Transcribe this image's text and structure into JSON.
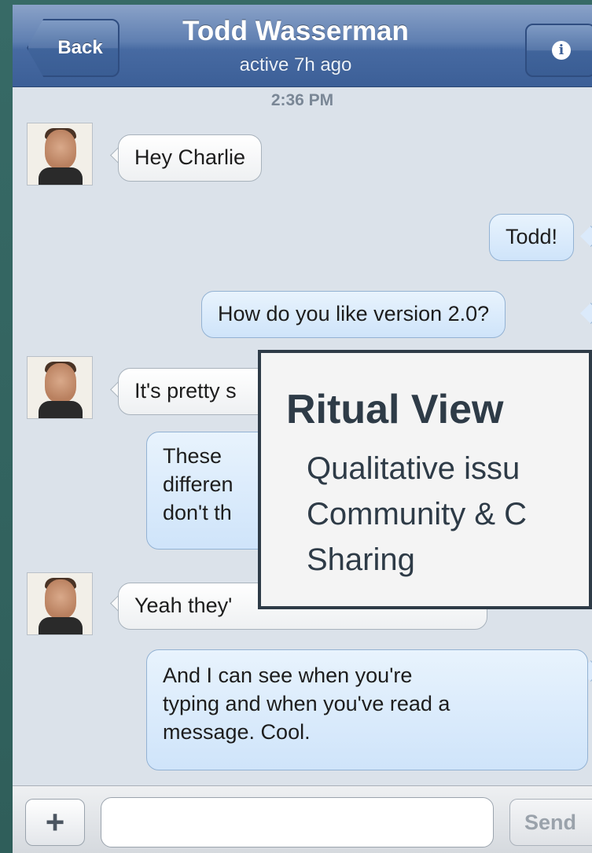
{
  "header": {
    "back_label": "Back",
    "contact_name": "Todd Wasserman",
    "status": "active 7h ago",
    "info_icon": "info-icon"
  },
  "conversation": {
    "timestamp": "2:36 PM",
    "messages": [
      {
        "from": "contact",
        "text": "Hey Charlie"
      },
      {
        "from": "me",
        "text": "Todd!"
      },
      {
        "from": "me",
        "text": "How do you like version 2.0?"
      },
      {
        "from": "contact",
        "text": "It's pretty s"
      },
      {
        "from": "me",
        "lines": [
          "These",
          "differen",
          "don't th"
        ]
      },
      {
        "from": "contact",
        "text": "Yeah they'"
      },
      {
        "from": "me",
        "lines": [
          "And I can see when you're",
          "typing and when you've read a",
          "message. Cool."
        ]
      }
    ]
  },
  "overlay": {
    "title": "Ritual View",
    "items": [
      "Qualitative issu",
      "Community & C",
      "Sharing"
    ]
  },
  "composer": {
    "add_icon": "plus-icon",
    "input_placeholder": "",
    "send_label": "Send"
  },
  "colors": {
    "navbar": "#4a6ca3",
    "incoming_bubble": "#f4f5f6",
    "outgoing_bubble": "#d9eafb",
    "overlay_text": "#2e3b47",
    "frame": "#2f5e5a"
  }
}
